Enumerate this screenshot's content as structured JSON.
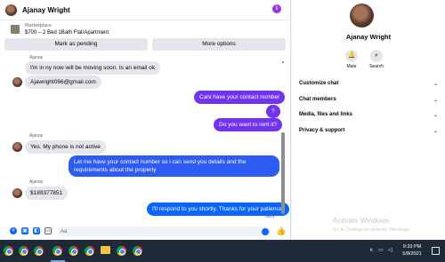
{
  "chat": {
    "contact_name": "Ajanay Wright",
    "more_icon": "info-icon",
    "marketplace": {
      "label": "Marketplace",
      "listing": "$700 – 2 Bed 1Bath Flat/Apartment"
    },
    "mark_pending_label": "Mark as pending",
    "more_options_label": "More options",
    "messages": [
      {
        "from": "them",
        "sender": "Ajanay",
        "text": "I'm in ny now will be moving soon. Is an email ok"
      },
      {
        "from": "them",
        "text": "Ajawright066@gmail.com"
      },
      {
        "from": "me",
        "text": "Cani have your contact number"
      },
      {
        "from": "me",
        "text": "?"
      },
      {
        "from": "me",
        "text": "Do you want to rent it?"
      },
      {
        "from": "them",
        "sender": "Ajanay",
        "text": "Yes. My phone is not active"
      },
      {
        "from": "me",
        "text": "Let me have your contact number so i can send you details and the requirements about the property"
      },
      {
        "from": "them",
        "sender": "Ajanay",
        "text": "$189377851"
      },
      {
        "from": "me",
        "text": "I'll respond to you shortly. Thanks for your patience."
      }
    ],
    "sent_status": "Sent",
    "composer_placeholder": "Aa",
    "colors": {
      "outgoing": "#0a65ff",
      "incoming": "#e4e6eb",
      "accent": "#9b36e6"
    }
  },
  "info": {
    "name": "Ajanay Wright",
    "mute_label": "Mute",
    "search_label": "Search",
    "sections": [
      "Customize chat",
      "Chat members",
      "Media, files and links",
      "Privacy & support"
    ],
    "watermark_title": "Activate Windows",
    "watermark_sub": "Go to Settings to activate Windows."
  },
  "taskbar": {
    "time": "9:33 PM",
    "date": "5/8/2021",
    "tray_icons": [
      "chevron-up-icon",
      "network-icon",
      "volume-icon"
    ],
    "apps": [
      "chrome-icon",
      "chrome-icon",
      "chrome-icon",
      "chrome-icon",
      "chrome-icon",
      "chrome-icon",
      "file-explorer-icon",
      "chrome-icon",
      "chrome-icon"
    ]
  }
}
